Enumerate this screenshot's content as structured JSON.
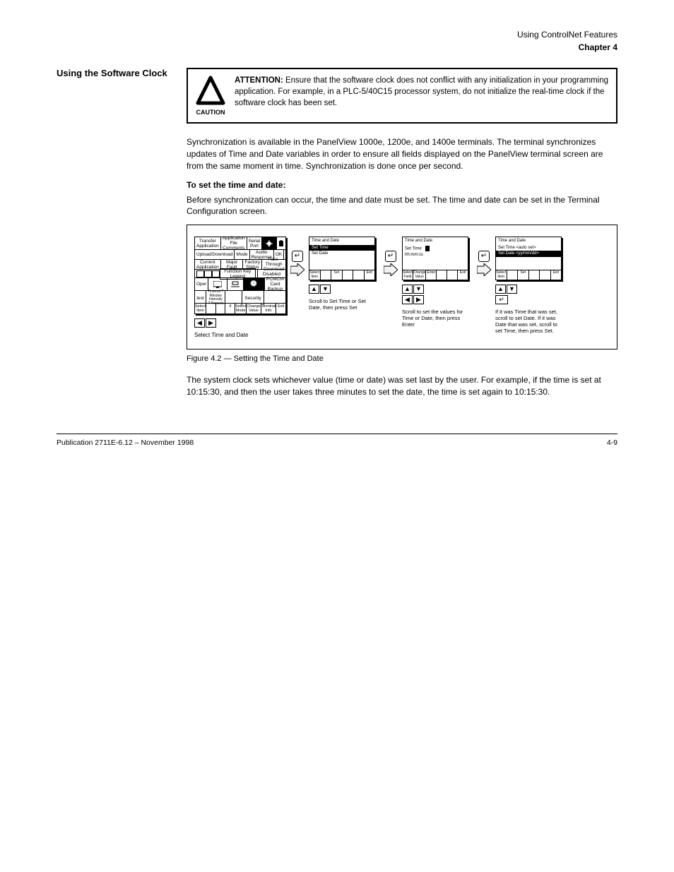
{
  "header": {
    "line1": "Using ControlNet Features",
    "line2_bold": "Chapter 4"
  },
  "section": {
    "label": "Using the Software Clock",
    "attention": {
      "caution": "CAUTION",
      "bold": "ATTENTION:",
      "text": " Ensure that the software clock does not conflict with any initialization in your programming application. For example, in a PLC-5/40C15 processor system, do not initialize the real-time clock if the software clock has been set."
    },
    "p1": "Synchronization is available in the PanelView 1000e, 1200e, and 1400e terminals. The terminal synchronizes updates of Time and Date variables in order to ensure all fields displayed on the PanelView terminal screen are from the same moment in time. Synchronization is done once per second.",
    "subhead": "To set the time and date:",
    "p2": "Before synchronization can occur, the time and date must be set. The time and date can be set in the Terminal Configuration screen.",
    "fig": {
      "screen1": {
        "r1c1": "Transfer Application",
        "r1c2": "Application File Comments",
        "r1c3": "Serial Port",
        "r1c4": "Align Screen",
        "r1c5": "Battery Power %",
        "r2c1": "Upload/Download",
        "r2c2": "Mode",
        "r2c3": "Audio Response",
        "r2c4": "OK",
        "r3c1": "Current Application",
        "r3c2": "Major Fault",
        "r3c3": "Factory Status",
        "r3c4": "Pass-Through Download",
        "r4c1_group": "Function Key Legend",
        "r4c5": "Disabled",
        "r5c1": "Oper",
        "r5c2": "Screen Saver",
        "r5c3": "Alarm Relay",
        "r5c4": "Time and Date",
        "r5c5": "PCMCIA Card Backup",
        "r6c1": "test",
        "r6c2": "Timeout ? Minutes Intensity ? Percent",
        "r6c4": "Security",
        "sk1": "Select Item",
        "sk2": "",
        "sk3": "",
        "sk4": "4",
        "sk5": "Select Mode",
        "sk6": "Change Value",
        "sk7": "Terminal Info",
        "sk8": "Exit",
        "cap_btns": "Select Time and Date"
      },
      "screen2": {
        "title": "Time and Date",
        "hl": "Set Time",
        "l1": "Set Date",
        "sk1": "Select Item",
        "sk3": "Set",
        "sk6": "Exit",
        "cap": "Scroll to Set Time or Set Date, then press Set"
      },
      "screen3": {
        "title": "Time and Date",
        "l1": "Set Time",
        "l2": "hh:mm:ss",
        "sk1": "Select",
        "sk2": "Field",
        "sk3": "Change",
        "sk4": "Value",
        "sk5": "Enter",
        "sk6": "Exit",
        "cap": "Scroll to set the values for Time or Date, then press Enter"
      },
      "screen4": {
        "title": "Time and Date",
        "l1": "Set Time <auto set>",
        "hl": "Set Date <yy/mm/dd>",
        "sk1": "Select Item",
        "sk3": "Set",
        "sk6": "Exit",
        "cap": "If it was Time that was set, scroll to set Date. If it was Date that was set, scroll to set Time, then press Set."
      }
    },
    "fig_caption": "Figure 4.2 — Setting the Time and Date",
    "p3": "The system clock sets whichever value (time or date) was set last by the user. For example, if the time is set at 10:15:30, and then the user takes three minutes to set the date, the time is set again to 10:15:30."
  },
  "footer": {
    "left": "Publication 2711E-6.12 – November 1998",
    "right": "4-9"
  }
}
